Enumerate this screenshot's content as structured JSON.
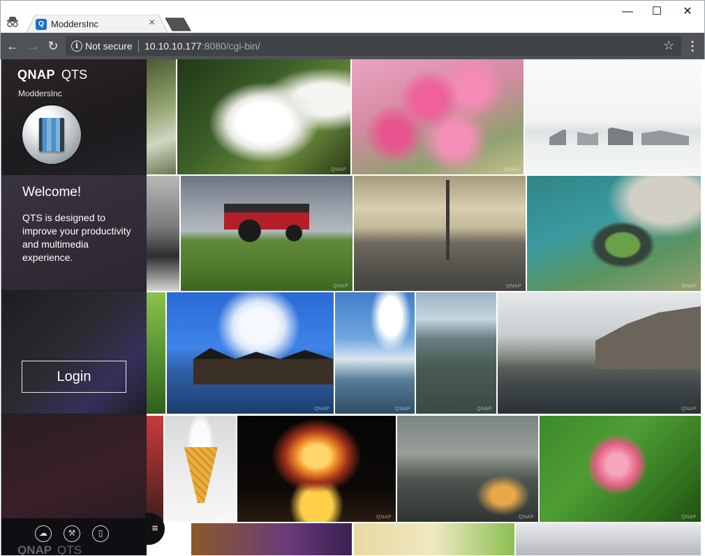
{
  "browser": {
    "tab_title": "ModdersInc",
    "tab_close": "×",
    "security_label": "Not secure",
    "url_host": "10.10.10.177",
    "url_rest": ":8080/cgi-bin/",
    "window_min": "—",
    "window_max": "☐",
    "window_close": "✕",
    "back": "←",
    "forward": "→",
    "reload": "↻",
    "star": "☆",
    "menu": "⋮",
    "info": "i"
  },
  "sidebar": {
    "brand_name": "QNAP",
    "brand_product": "QTS",
    "hostname": "ModdersInc",
    "welcome_title": "Welcome!",
    "welcome_text": "QTS is designed to improve your productivity and multimedia experience.",
    "login_label": "Login",
    "footer_brand": "QNAP",
    "footer_product": "QTS",
    "menu_toggle": "≡"
  },
  "icons": {
    "incognito": "incognito-icon",
    "favicon": "qnap-favicon-icon",
    "cloud": "cloud-icon",
    "tools": "tools-icon",
    "manual": "manual-icon"
  },
  "photo_watermark": "QNAP",
  "colors": {
    "toolbar": "#505356",
    "omnibox": "#404346",
    "sidebar": "#1f1c22"
  }
}
